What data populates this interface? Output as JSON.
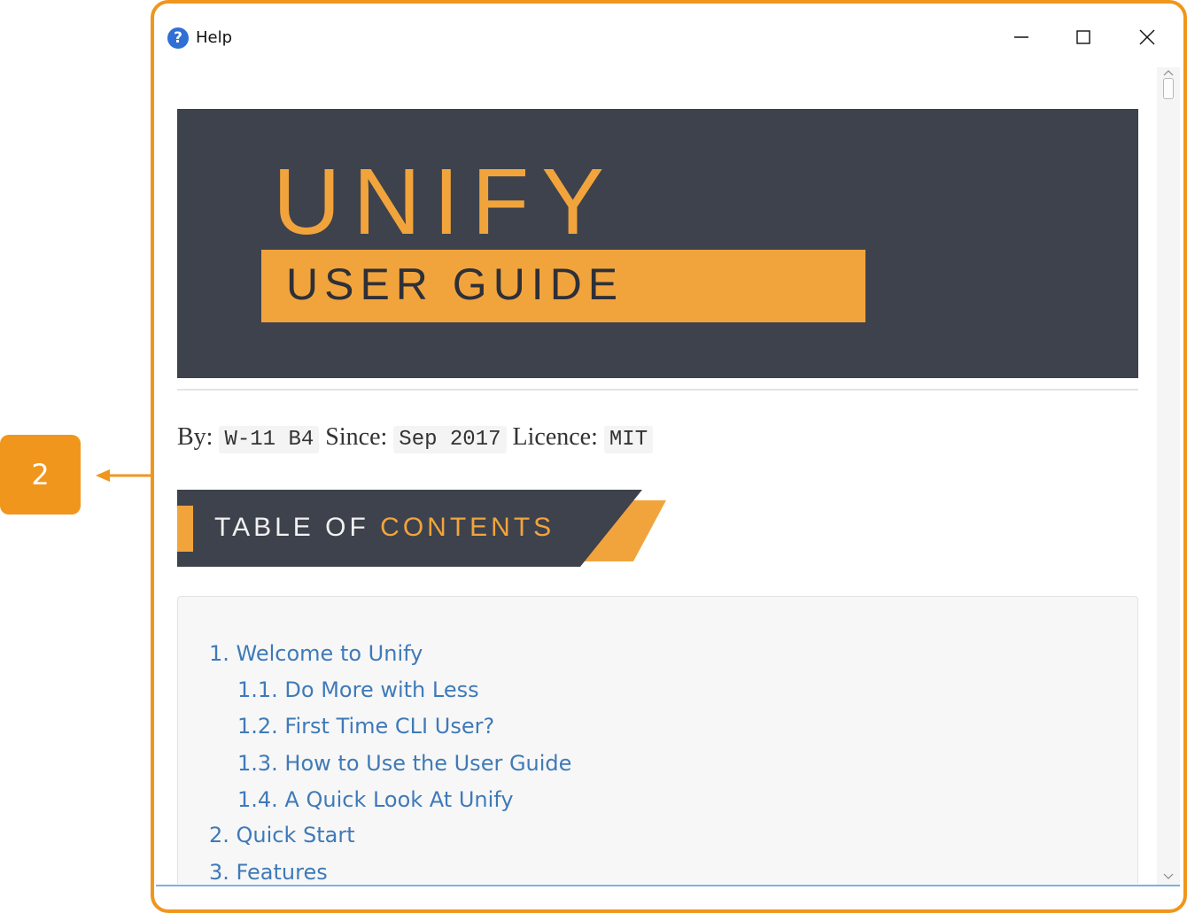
{
  "callout": {
    "number": "2"
  },
  "window": {
    "title": "Help",
    "icons": {
      "app": "help-question-icon",
      "minimize": "minimize-icon",
      "maximize": "maximize-icon",
      "close": "close-icon"
    },
    "colors": {
      "highlight": "#f0961c",
      "link": "#3f7ab8",
      "banner_bg": "#3e424c",
      "accent": "#f2a43c"
    }
  },
  "banner": {
    "title": "UNIFY",
    "subtitle": "USER GUIDE"
  },
  "meta": {
    "by_label": "By:",
    "by_value": "W-11 B4",
    "since_label": "Since:",
    "since_value": "Sep 2017",
    "licence_label": "Licence:",
    "licence_value": "MIT"
  },
  "toc": {
    "heading_part1": "TABLE OF ",
    "heading_part2": "CONTENTS",
    "items": [
      {
        "label": "1. Welcome to Unify",
        "level": 1
      },
      {
        "label": "1.1. Do More with Less",
        "level": 2
      },
      {
        "label": "1.2. First Time CLI User?",
        "level": 2
      },
      {
        "label": "1.3. How to Use the User Guide",
        "level": 2
      },
      {
        "label": "1.4. A Quick Look At Unify",
        "level": 2
      },
      {
        "label": "2. Quick Start",
        "level": 1
      },
      {
        "label": "3. Features",
        "level": 1
      }
    ]
  }
}
